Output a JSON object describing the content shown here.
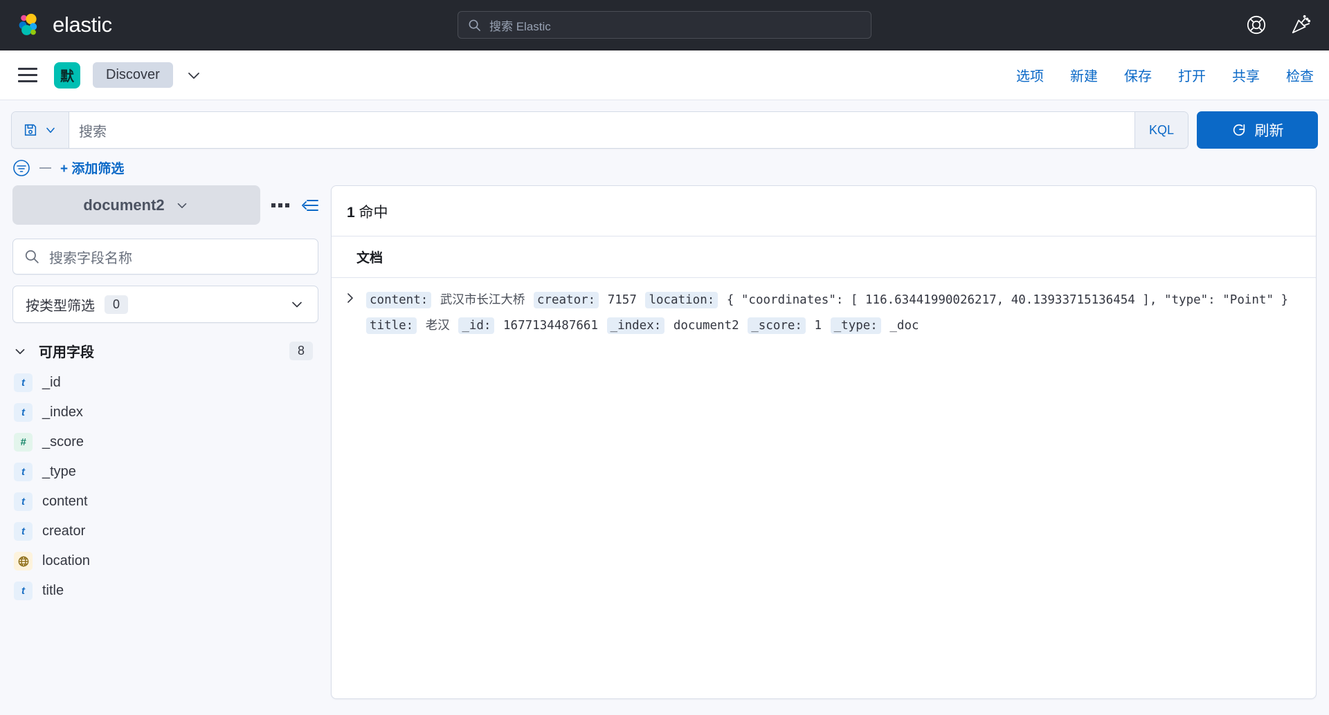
{
  "header": {
    "brand_name": "elastic",
    "search_placeholder": "搜索 Elastic",
    "icons": [
      {
        "name": "help-icon",
        "label": "帮助"
      },
      {
        "name": "whats-new-icon",
        "label": "新功能"
      }
    ]
  },
  "nav": {
    "menu_label": "菜单",
    "space_badge": "默",
    "breadcrumb": "Discover",
    "links": [
      "选项",
      "新建",
      "保存",
      "打开",
      "共享",
      "检查"
    ]
  },
  "query": {
    "saved_query_icon": "save-icon",
    "placeholder": "搜索",
    "value": "",
    "language": "KQL",
    "refresh_label": "刷新"
  },
  "filters": {
    "add_filter_label": "+ 添加筛选"
  },
  "sidebar": {
    "index_pattern": "document2",
    "field_search_placeholder": "搜索字段名称",
    "type_filter_label": "按类型筛选",
    "type_filter_count": "0",
    "available_fields_label": "可用字段",
    "available_fields_count": "8",
    "fields": [
      {
        "name": "_id",
        "type": "string",
        "glyph": "t"
      },
      {
        "name": "_index",
        "type": "string",
        "glyph": "t"
      },
      {
        "name": "_score",
        "type": "number",
        "glyph": "#"
      },
      {
        "name": "_type",
        "type": "string",
        "glyph": "t"
      },
      {
        "name": "content",
        "type": "string",
        "glyph": "t"
      },
      {
        "name": "creator",
        "type": "string",
        "glyph": "t"
      },
      {
        "name": "location",
        "type": "geo",
        "glyph": "⊕"
      },
      {
        "name": "title",
        "type": "string",
        "glyph": "t"
      }
    ]
  },
  "main": {
    "hits_count": "1",
    "hits_label": "命中",
    "table_header": "文档",
    "rows": [
      {
        "fields": [
          {
            "key": "content:",
            "value": "武汉市长江大桥",
            "cjk": true
          },
          {
            "key": "creator:",
            "value": "7157",
            "cjk": false
          },
          {
            "key": "location:",
            "value": "{ \"coordinates\": [ 116.63441990026217, 40.13933715136454 ], \"type\": \"Point\" }",
            "cjk": false
          },
          {
            "key": "title:",
            "value": "老汉",
            "cjk": true
          },
          {
            "key": "_id:",
            "value": "1677134487661",
            "cjk": false
          },
          {
            "key": "_index:",
            "value": "document2",
            "cjk": false
          },
          {
            "key": "_score:",
            "value": "1",
            "cjk": false
          },
          {
            "key": "_type:",
            "value": "_doc",
            "cjk": false
          }
        ]
      }
    ]
  },
  "colors": {
    "header_bg": "#25282f",
    "accent_blue": "#0b69c7",
    "space_teal": "#00bfb3",
    "string_type": "#1a6fc4",
    "number_type": "#17866a",
    "geo_type": "#8a6a12"
  }
}
